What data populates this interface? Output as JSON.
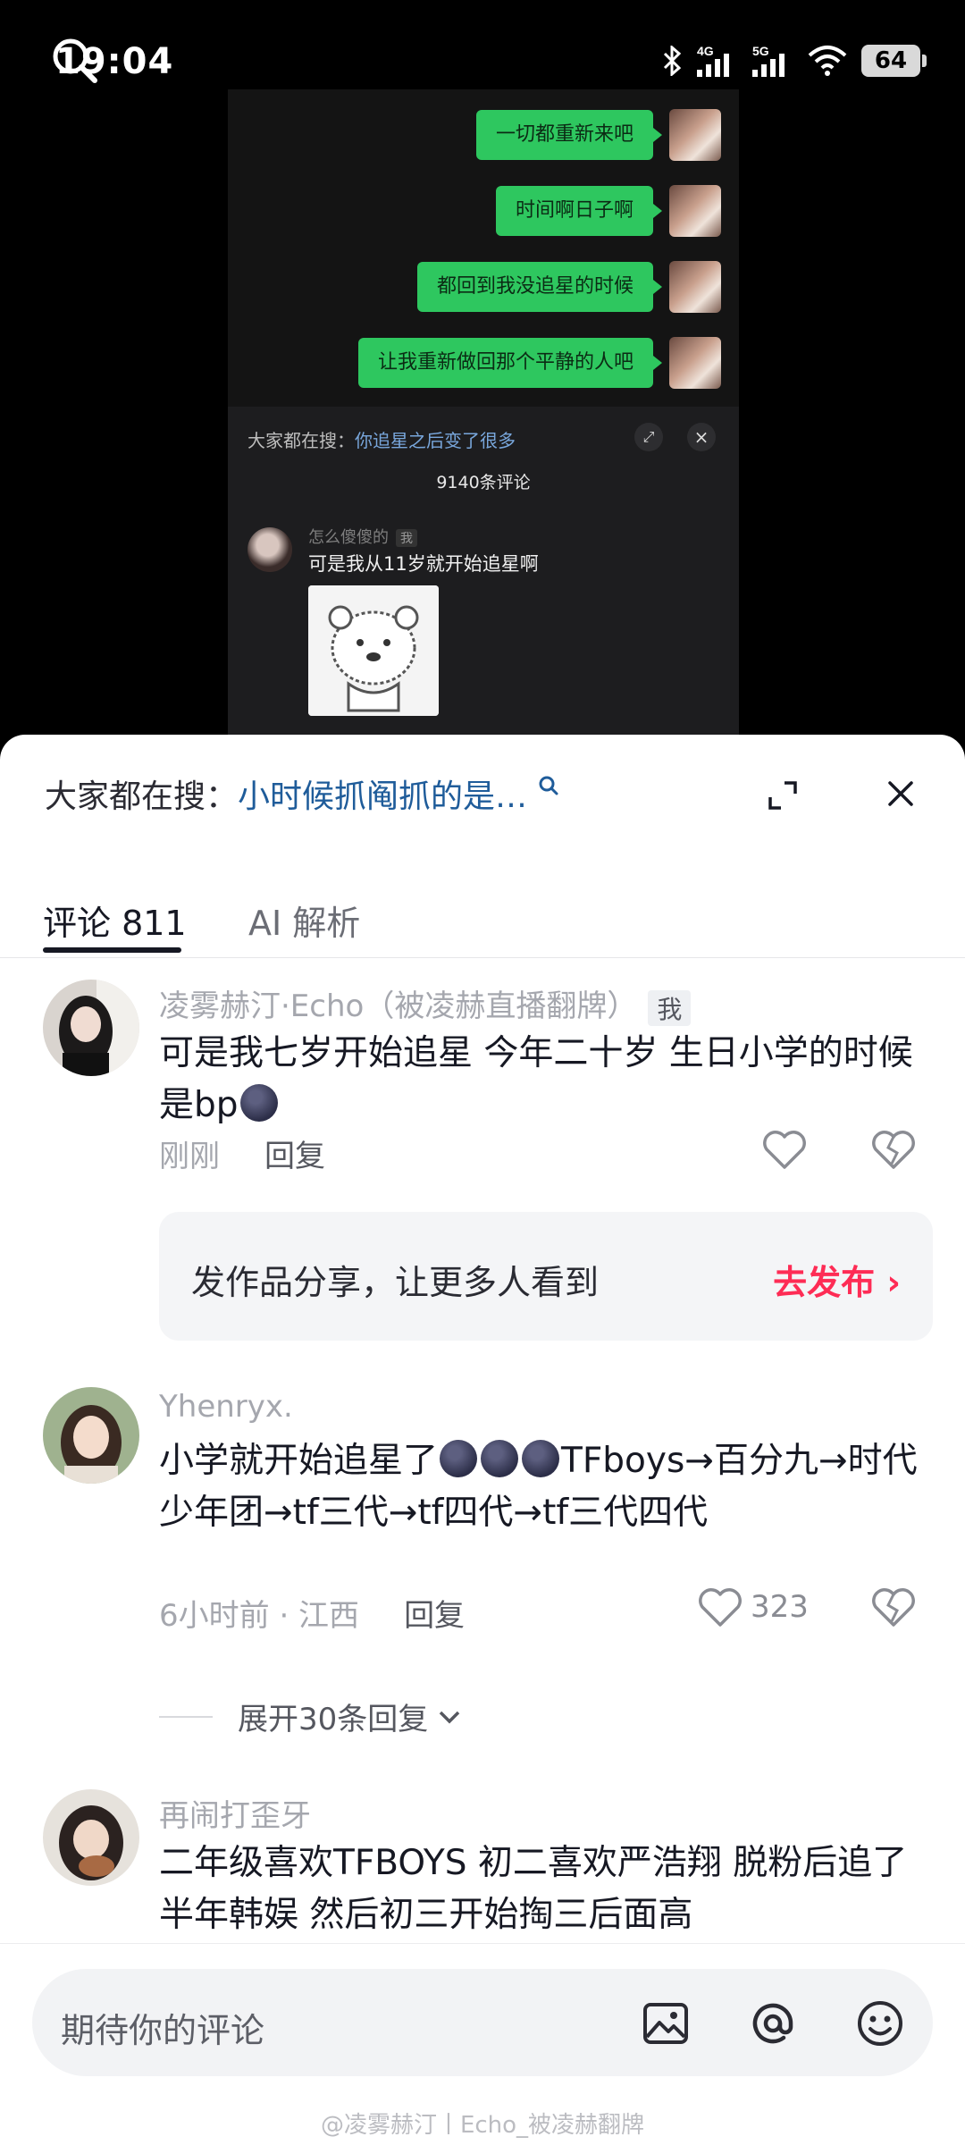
{
  "status_bar": {
    "time": "19:04",
    "network_1": "4G",
    "network_2": "5G",
    "battery": "64"
  },
  "video": {
    "messages": [
      "一切都重新来吧",
      "时间啊日子啊",
      "都回到我没追星的时候",
      "让我重新做回那个平静的人吧"
    ],
    "inner_search_label": "大家都在搜：",
    "inner_search_term": "你追星之后变了很多",
    "inner_comment_count": "9140条评论",
    "inner_comment_name": "怎么傻傻的",
    "inner_comment_badge": "我",
    "inner_comment_text": "可是我从11岁就开始追星啊"
  },
  "sheet": {
    "search_label": "大家都在搜：",
    "search_term": "小时候抓阄抓的是…",
    "tabs": [
      {
        "label": "评论 811",
        "active": true
      },
      {
        "label": "AI 解析",
        "active": false
      }
    ]
  },
  "comments": [
    {
      "name": "凌雾赫汀·Echo（被凌赫直播翻牌）",
      "badge": "我",
      "text": "可是我七岁开始追星 今年二十岁 生日小学的时候是bp",
      "time": "刚刚",
      "reply": "回复",
      "likes": ""
    },
    {
      "name": "Yhenryx.",
      "text_lead": "小学就开始追星了",
      "text_tail": "TFboys→百分九→时代少年团→tf三代→tf四代→tf三代四代",
      "time": "6小时前 · 江西",
      "reply": "回复",
      "likes": "323",
      "expand": "展开30条回复"
    },
    {
      "name": "再闹打歪牙",
      "text": "二年级喜欢TFBOYS 初二喜欢严浩翔 脱粉后追了半年韩娱 然后初三开始掏三后面高"
    }
  ],
  "promo": {
    "text": "发作品分享，让更多人看到",
    "link": "去发布 ›"
  },
  "input": {
    "placeholder": "期待你的评论"
  },
  "watermark": "@凌雾赫汀丨Echo_被凌赫翻牌",
  "colors": {
    "accent": "#fe2c55",
    "search_term": "#1f5c9a",
    "chat_bubble": "#2ec75f"
  }
}
